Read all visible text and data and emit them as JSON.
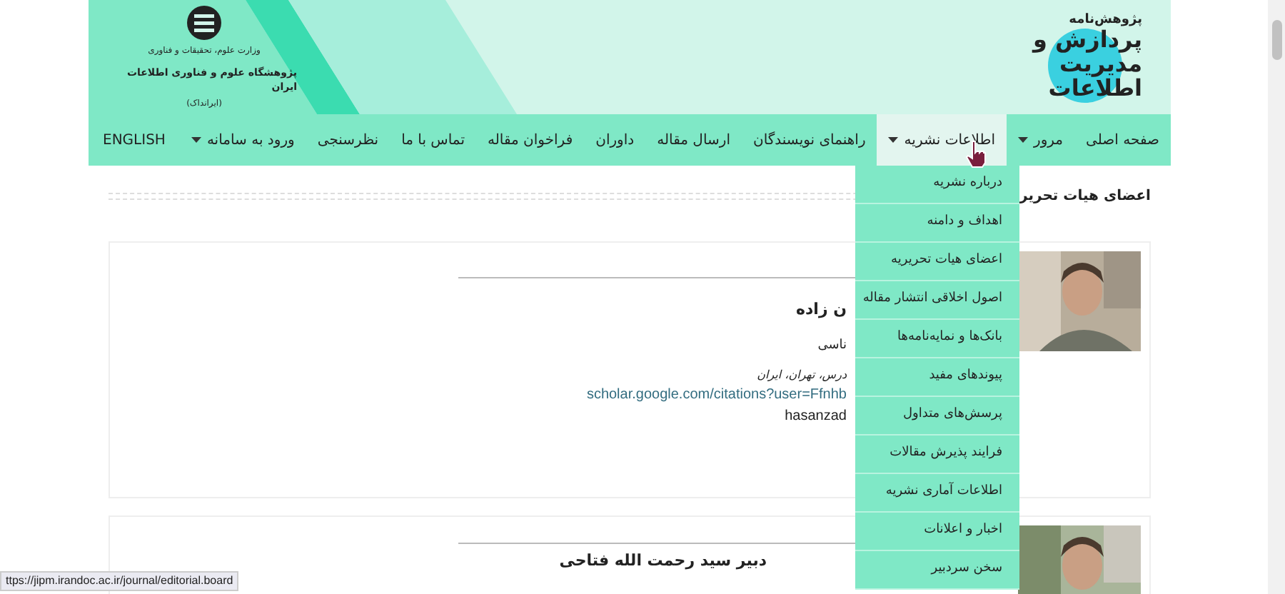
{
  "header": {
    "logo_lines": [
      "پژوهش‌نامه",
      "پردازش و",
      "مدیریت",
      "اطلاعات"
    ],
    "institute_lines": [
      "وزارت علوم، تحقیقات و فناوری",
      "پژوهشگاه علوم و فناوری اطلاعات ایران",
      "(ایرانداک)"
    ]
  },
  "nav": {
    "items": [
      {
        "label": "صفحه اصلی",
        "dropdown": false,
        "selected": false
      },
      {
        "label": "مرور",
        "dropdown": true,
        "selected": false
      },
      {
        "label": "اطلاعات نشریه",
        "dropdown": true,
        "selected": true
      },
      {
        "label": "راهنمای نویسندگان",
        "dropdown": false,
        "selected": false
      },
      {
        "label": "ارسال مقاله",
        "dropdown": false,
        "selected": false
      },
      {
        "label": "داوران",
        "dropdown": false,
        "selected": false
      },
      {
        "label": "فراخوان مقاله",
        "dropdown": false,
        "selected": false
      },
      {
        "label": "تماس با ما",
        "dropdown": false,
        "selected": false
      },
      {
        "label": "نظرسنجی",
        "dropdown": false,
        "selected": false
      }
    ],
    "login": {
      "label": "ورود به سامانه",
      "dropdown": true
    },
    "language": "ENGLISH"
  },
  "dropdown_menu": [
    "درباره نشریه",
    "اهداف و دامنه",
    "اعضای هیات تحریریه",
    "اصول اخلاقی انتشار مقاله",
    "بانک‌ها و نمایه‌نامه‌ها",
    "پیوندهای مفید",
    "پرسش‌های متداول",
    "فرایند پذیرش مقالات",
    "اطلاعات آماری نشریه",
    "اخبار و اعلانات",
    "سخن سردبیر"
  ],
  "page_title": "اعضای هیات تحریر",
  "members": [
    {
      "name": "ن زاده",
      "role": "ناسی",
      "affiliation": "درس، تهران، ایران",
      "link": "scholar.google.com/citations?user=Ffnhb",
      "email": "hasanzad"
    },
    {
      "name": "دبیر سید رحمت الله فتاحی"
    }
  ],
  "status_url": "ttps://jipm.irandoc.ac.ir/journal/editorial.board"
}
